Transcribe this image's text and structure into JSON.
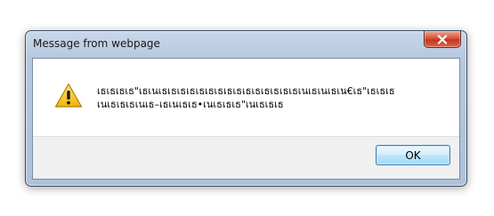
{
  "dialog": {
    "title": "Message from webpage",
    "message_line1": "เธเธ‍เธ‍เธ\"เธ‍เนเธ‍เธ‍เธ‍เธเธ‍เธ‍เธ‍เธเธ‍เธ‍เธ‍เธ‍เธเธ‍เธ‍เนเธ‍เนเธ‍เน€เธ\"เธ‍เธ‍เธ",
    "message_line2": "เนเธ‍เธ‍เธเนเธ–เธ‍เนเธ‍เธ•เนเธ‍เธ‍เธ\"เนเธ‍เธ‍เธ‍",
    "ok_label": "OK",
    "icon": "warning-icon",
    "close_icon": "close-icon"
  }
}
